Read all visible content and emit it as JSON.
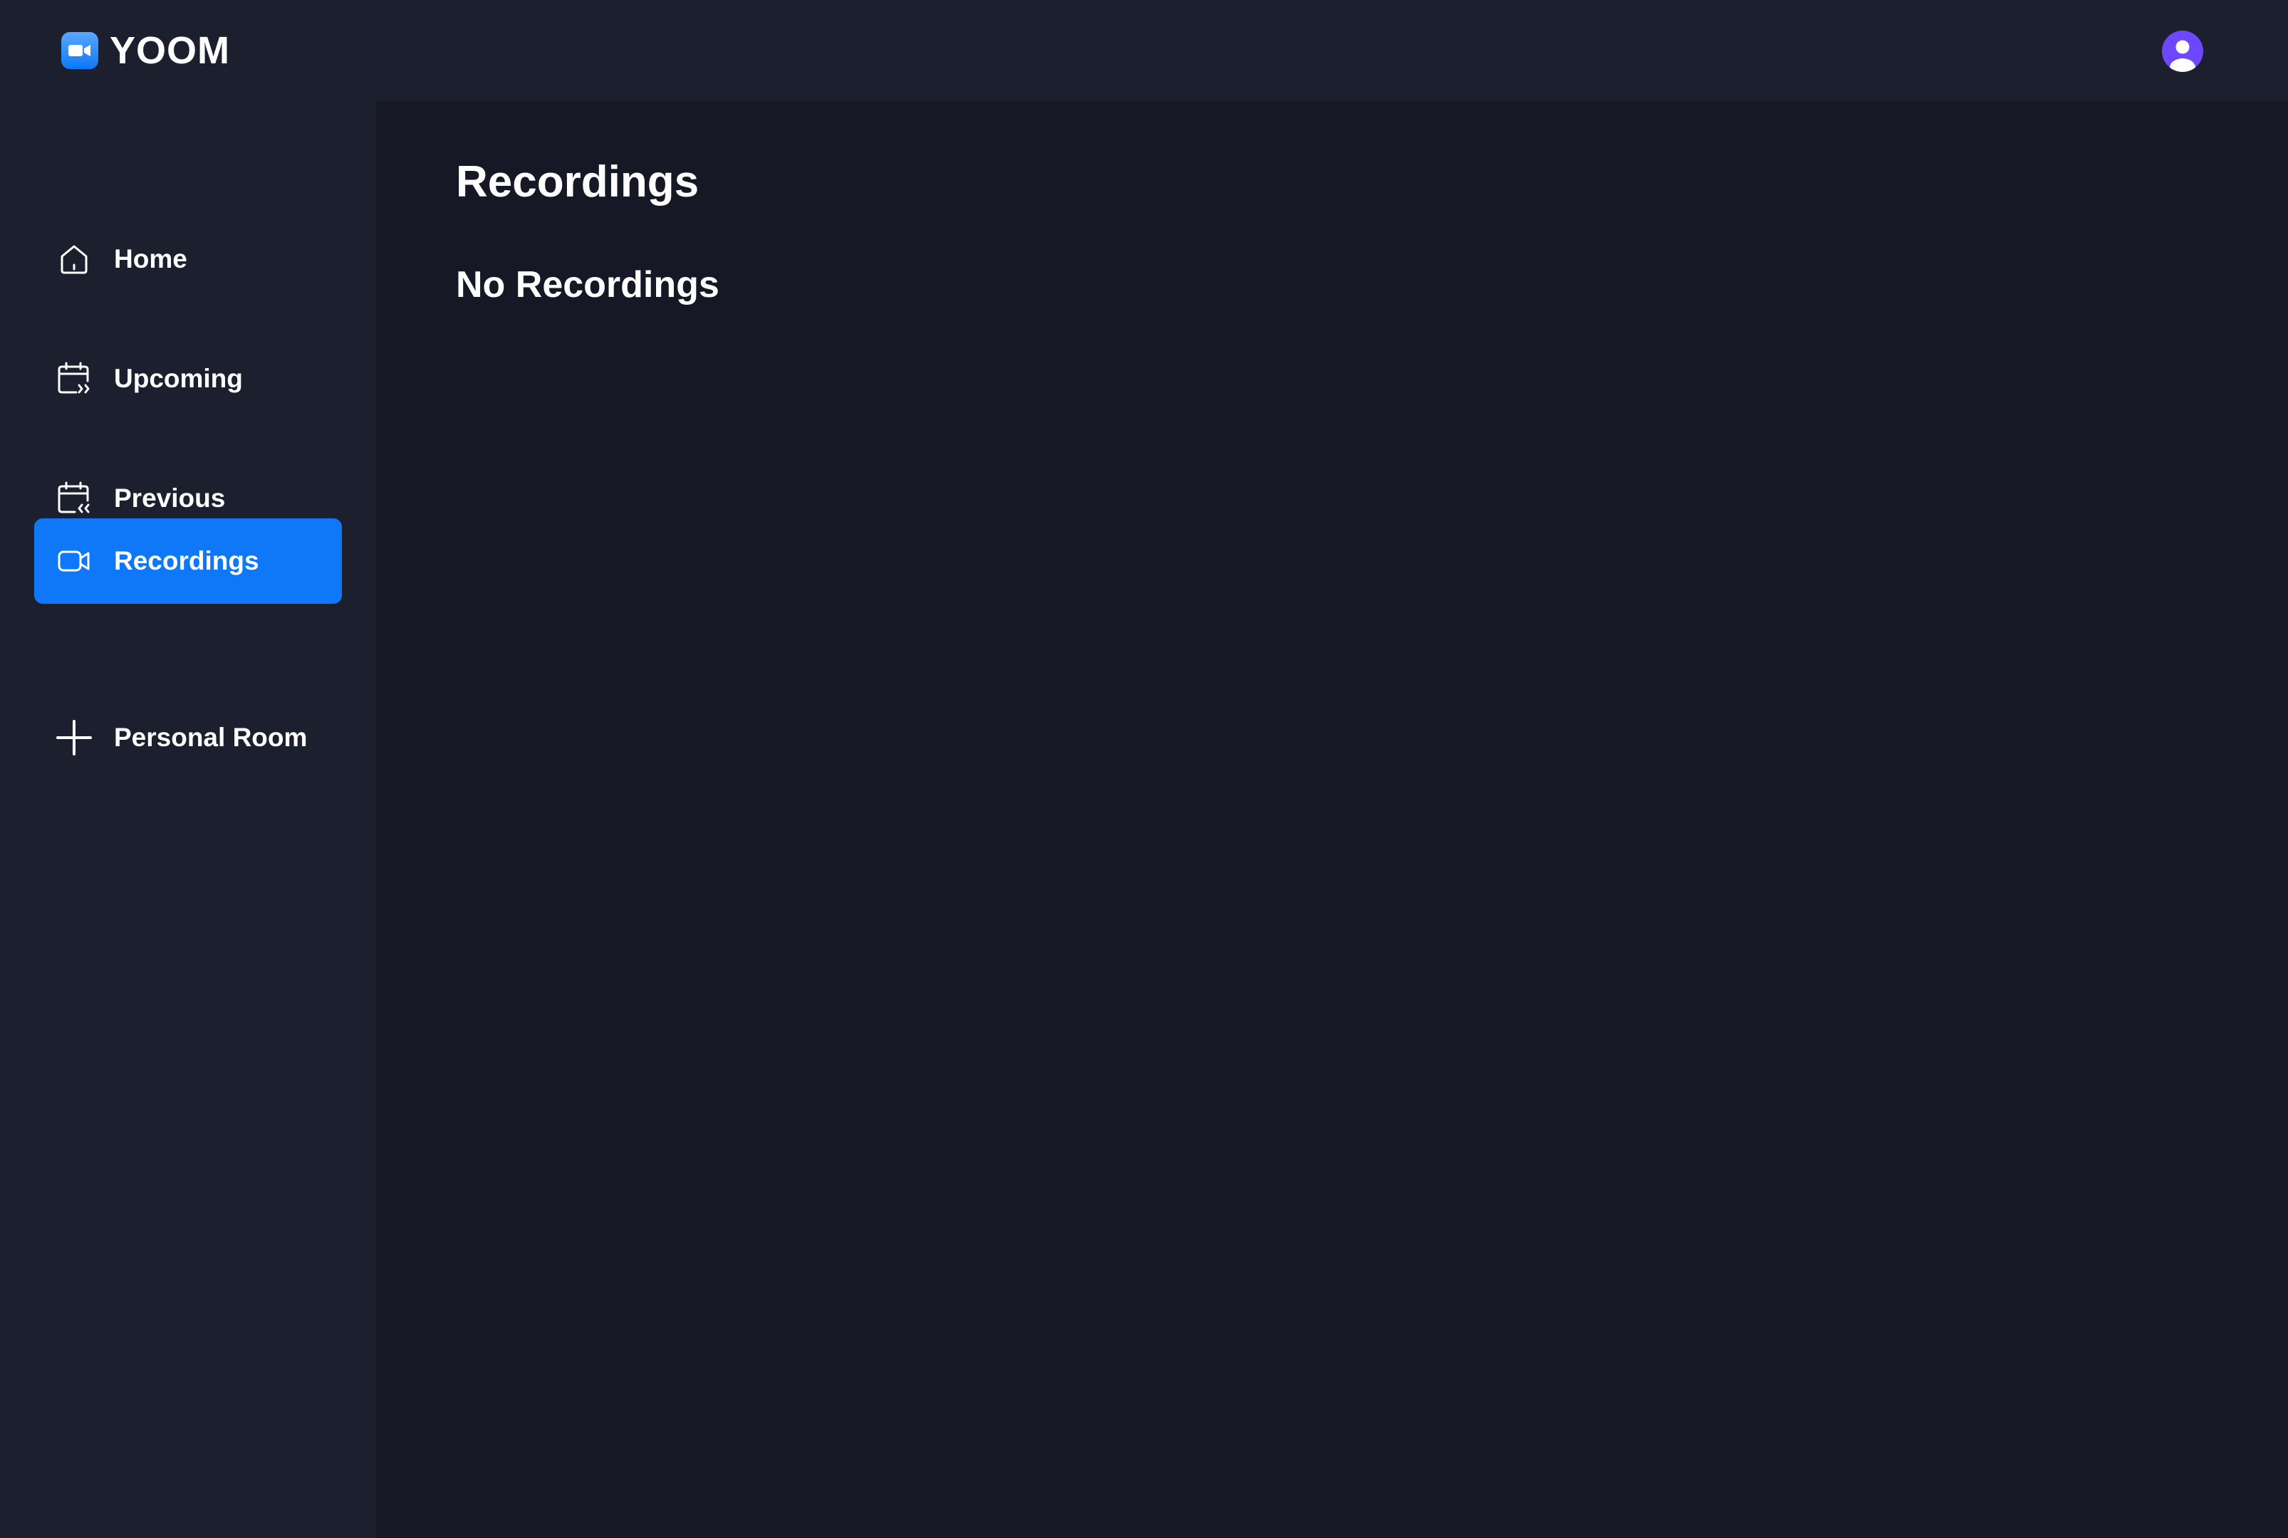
{
  "app": {
    "name": "YOOM",
    "logo_icon": "video-camera-icon"
  },
  "header": {
    "avatar_icon": "user-avatar-icon"
  },
  "sidebar": {
    "items": [
      {
        "label": "Home",
        "icon": "home-icon",
        "active": false
      },
      {
        "label": "Upcoming",
        "icon": "calendar-upcoming-icon",
        "active": false
      },
      {
        "label": "Previous",
        "icon": "calendar-previous-icon",
        "active": false
      },
      {
        "label": "Recordings",
        "icon": "video-icon",
        "active": true
      },
      {
        "label": "Personal Room",
        "icon": "plus-icon",
        "active": false
      }
    ]
  },
  "main": {
    "title": "Recordings",
    "empty_message": "No Recordings"
  },
  "colors": {
    "accent": "#0E78F9",
    "sidebar_bg": "#1C1F2E",
    "main_bg": "#161925",
    "avatar_bg": "#6C47FF"
  }
}
